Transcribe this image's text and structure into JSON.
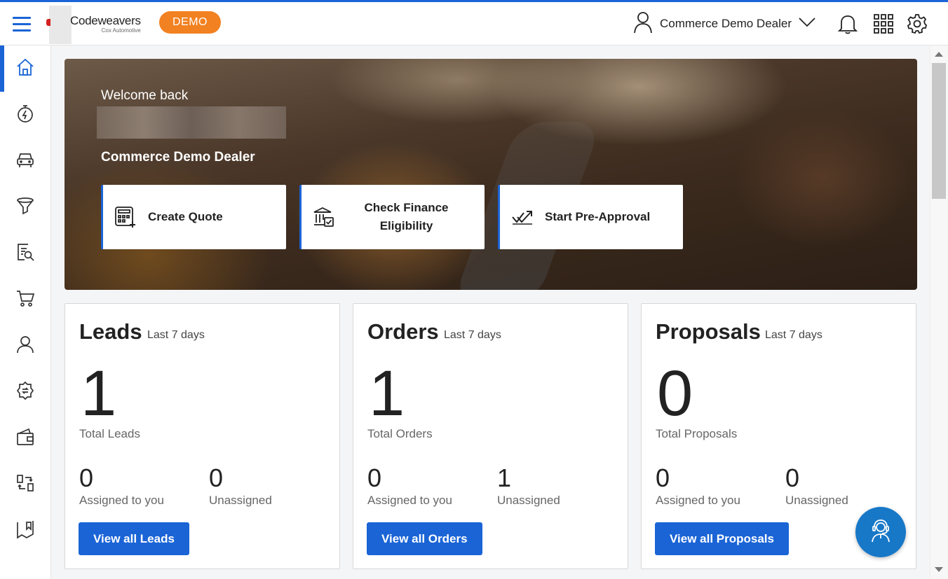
{
  "brand": {
    "name": "Codeweavers",
    "tagline": "Cox Automotive",
    "badge": "DEMO"
  },
  "header": {
    "dealer_name": "Commerce Demo Dealer",
    "icons": [
      "user-icon",
      "chevron-down-icon",
      "bell-icon",
      "apps-grid-icon",
      "gear-icon"
    ]
  },
  "sidebar": {
    "items": [
      {
        "icon": "home-icon",
        "active": true
      },
      {
        "icon": "stopwatch-icon"
      },
      {
        "icon": "car-icon"
      },
      {
        "icon": "funnel-icon"
      },
      {
        "icon": "document-search-icon"
      },
      {
        "icon": "cart-icon"
      },
      {
        "icon": "users-icon"
      },
      {
        "icon": "exchange-badge-icon"
      },
      {
        "icon": "wallet-icon"
      },
      {
        "icon": "transfer-icon"
      },
      {
        "icon": "map-bookmark-icon"
      }
    ]
  },
  "hero": {
    "welcome": "Welcome back",
    "dealer": "Commerce Demo Dealer",
    "actions": [
      {
        "label": "Create Quote",
        "icon": "calculator-icon"
      },
      {
        "label": "Check Finance Eligibility",
        "label_line1": "Check Finance",
        "label_line2": "Eligibility",
        "icon": "bank-check-icon"
      },
      {
        "label": "Start Pre-Approval",
        "icon": "approval-check-icon"
      }
    ]
  },
  "cards": [
    {
      "title": "Leads",
      "period": "Last 7 days",
      "total": "1",
      "total_label": "Total Leads",
      "assigned": "0",
      "assigned_label": "Assigned to you",
      "unassigned": "0",
      "unassigned_label": "Unassigned",
      "button": "View all Leads"
    },
    {
      "title": "Orders",
      "period": "Last 7 days",
      "total": "1",
      "total_label": "Total Orders",
      "assigned": "0",
      "assigned_label": "Assigned to you",
      "unassigned": "1",
      "unassigned_label": "Unassigned",
      "button": "View all Orders"
    },
    {
      "title": "Proposals",
      "period": "Last 7 days",
      "total": "0",
      "total_label": "Total Proposals",
      "assigned": "0",
      "assigned_label": "Assigned to you",
      "unassigned": "0",
      "unassigned_label": "Unassigned",
      "button": "View all Proposals"
    }
  ],
  "colors": {
    "accent": "#1a64d6",
    "demo_badge": "#f28121",
    "support_button": "#1878c8"
  }
}
